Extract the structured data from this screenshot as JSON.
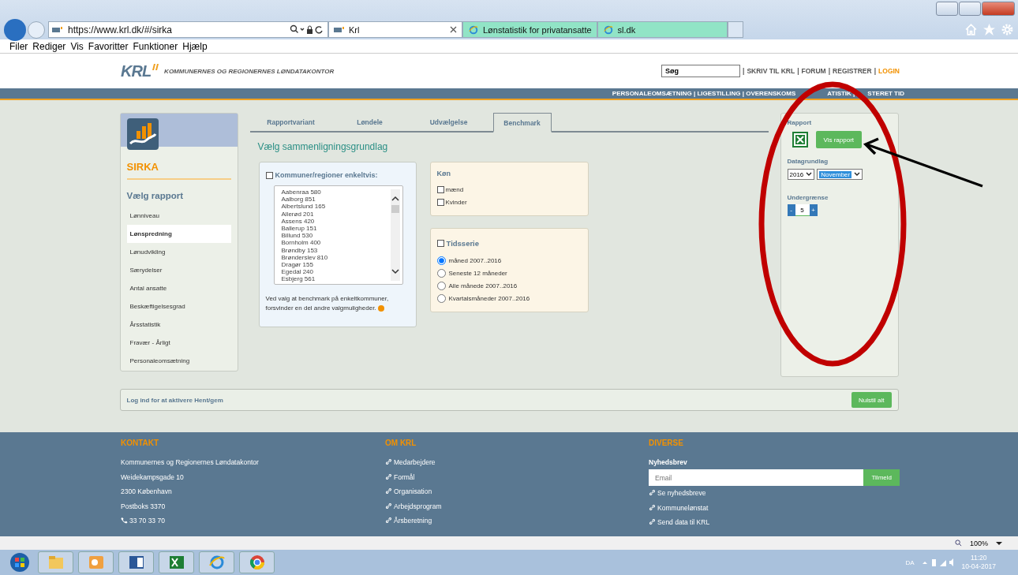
{
  "browser": {
    "address": "https://www.krl.dk/#/sirka",
    "tabs": [
      {
        "label": "Krl",
        "selected": true,
        "kind": "krl"
      },
      {
        "label": "Lønstatistik for privatansatte",
        "selected": false,
        "kind": "ie"
      },
      {
        "label": "sl.dk",
        "selected": false,
        "kind": "ie"
      }
    ],
    "menu": [
      "Filer",
      "Rediger",
      "Vis",
      "Favoritter",
      "Funktioner",
      "Hjælp"
    ]
  },
  "header": {
    "logo": "KRL",
    "tagline": "KOMMUNERNES OG REGIONERNES LØNDATAKONTOR",
    "search_value": "Søg",
    "separator": "|",
    "links": [
      {
        "label": "SKRIV TIL KRL",
        "kind": "plain"
      },
      {
        "label": "FORUM",
        "kind": "plain"
      },
      {
        "label": "REGISTRER",
        "kind": "plain"
      },
      {
        "label": "LOGIN",
        "kind": "accent"
      }
    ]
  },
  "nav_fragments": [
    "PERSONALEOMSÆTNING | LIGESTILLING | OVERENSKOMS",
    "ATISTIK |",
    "STERET TID"
  ],
  "sidebar": {
    "app_name": "SIRKA",
    "heading": "Vælg rapport",
    "items": [
      {
        "label": "Lønniveau",
        "selected": false
      },
      {
        "label": "Lønspredning",
        "selected": true
      },
      {
        "label": "Lønudvikling",
        "selected": false
      },
      {
        "label": "Særydelser",
        "selected": false
      },
      {
        "label": "Antal ansatte",
        "selected": false
      },
      {
        "label": "Beskæftigelsesgrad",
        "selected": false
      },
      {
        "label": "Årsstatistik",
        "selected": false
      },
      {
        "label": "Fravær - Årligt",
        "selected": false
      },
      {
        "label": "Personaleomsætning",
        "selected": false
      }
    ]
  },
  "tabs": [
    {
      "label": "Rapportvariant",
      "selected": false
    },
    {
      "label": "Løndele",
      "selected": false
    },
    {
      "label": "Udvælgelse",
      "selected": false
    },
    {
      "label": "Benchmark",
      "selected": true
    }
  ],
  "title": "Vælg sammenligningsgrundlag",
  "municipalities": {
    "label": "Kommuner/regioner enkeltvis:",
    "checked": false,
    "items": [
      "Aabenraa 580",
      "Aalborg 851",
      "Albertslund 165",
      "Allerød 201",
      "Assens 420",
      "Ballerup 151",
      "Billund 530",
      "Bornholm 400",
      "Brøndby 153",
      "Brønderslev 810",
      "Dragør 155",
      "Egedal 240",
      "Esbjerg 561"
    ],
    "note": "Ved valg at benchmark på enkeltkommuner, forsvinder en del andre valgmuligheder."
  },
  "gender": {
    "title": "Køn",
    "options": [
      {
        "label": "mænd",
        "checked": false
      },
      {
        "label": "Kvinder",
        "checked": false
      }
    ]
  },
  "timeseries": {
    "title": "Tidsserie",
    "checked": false,
    "options": [
      {
        "label": "måned 2007..2016",
        "selected": true
      },
      {
        "label": "Seneste 12 måneder",
        "selected": false
      },
      {
        "label": "Alle månede 2007..2016",
        "selected": false
      },
      {
        "label": "Kvartalsmåneder 2007..2016",
        "selected": false
      }
    ]
  },
  "report": {
    "title": "Rapport",
    "button": "Vis rapport",
    "data_label": "Datagrundlag",
    "year": "2016",
    "month": "November",
    "limit_label": "Undergrænse",
    "minus": "-",
    "limit": "5",
    "plus": "+"
  },
  "login_bar": {
    "text": "Log ind for at aktivere Hent/gem",
    "button": "Nulstil alt"
  },
  "footer": {
    "contact": {
      "title": "KONTAKT",
      "lines": [
        "Kommunernes og Regionernes Løndatakontor",
        "Weidekampsgade 10",
        "2300 København",
        "Postboks 3370"
      ],
      "phone": "33 70 33 70"
    },
    "about": {
      "title": "OM KRL",
      "links": [
        "Medarbejdere",
        "Formål",
        "Organisation",
        "Arbejdsprogram",
        "Årsberetning"
      ]
    },
    "misc": {
      "title": "DIVERSE",
      "newsletter": "Nyhedsbrev",
      "email_placeholder": "Email",
      "subscribe": "Tilmeld",
      "links": [
        "Se nyhedsbreve",
        "Kommunelønstat",
        "Send data til KRL"
      ]
    }
  },
  "status_bar": {
    "zoom": "100%"
  },
  "taskbar": {
    "language": "DA",
    "time": "11:20",
    "date": "10-04-2017"
  }
}
